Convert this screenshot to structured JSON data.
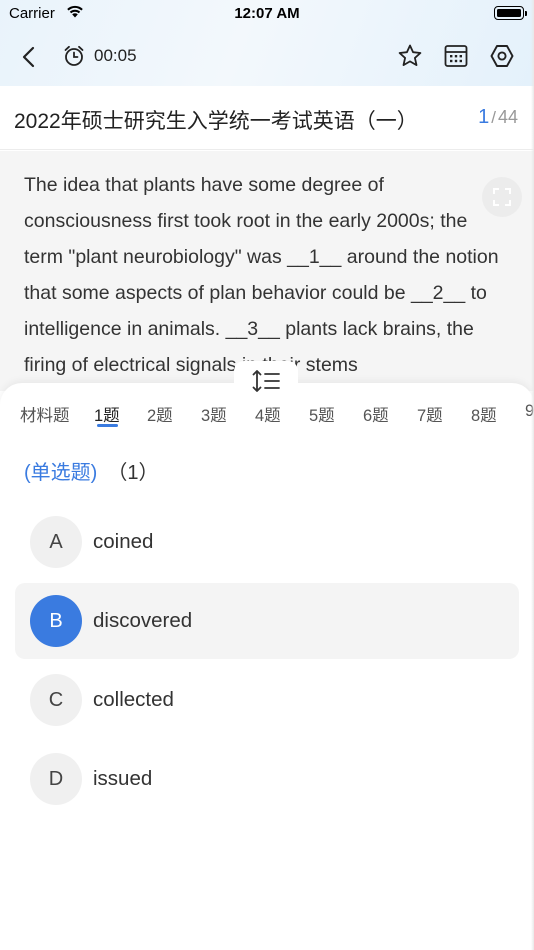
{
  "status_bar": {
    "carrier": "Carrier",
    "time": "12:07 AM"
  },
  "nav": {
    "timer": "00:05",
    "icons": {
      "back": "chevron-left-icon",
      "timer": "alarm-clock-icon",
      "favorite": "star-icon",
      "answer_sheet": "calculator-grid-icon",
      "settings": "hexagon-gear-icon"
    }
  },
  "exam": {
    "title": "2022年硕士研究生入学统一考试英语（一）",
    "current": "1",
    "separator": "/",
    "total": "44"
  },
  "passage": {
    "text": "The idea that plants have some degree of consciousness first took root in the early 2000s; the term \"plant neurobiology\" was __1__ around the notion that some aspects of plan behavior could be __2__ to intelligence in animals. __3__ plants lack brains, the firing of electrical signals in their stems"
  },
  "tabs": [
    "材料题",
    "1题",
    "2题",
    "3题",
    "4题",
    "5题",
    "6题",
    "7题",
    "8题",
    "9"
  ],
  "question": {
    "type": "(单选题)",
    "number": "（1）"
  },
  "options": [
    {
      "letter": "A",
      "text": "coined",
      "selected": false
    },
    {
      "letter": "B",
      "text": "discovered",
      "selected": true
    },
    {
      "letter": "C",
      "text": "collected",
      "selected": false
    },
    {
      "letter": "D",
      "text": "issued",
      "selected": false
    }
  ],
  "colors": {
    "accent": "#3a7be0",
    "text": "#333333",
    "passage_bg": "#f5f5f5"
  }
}
